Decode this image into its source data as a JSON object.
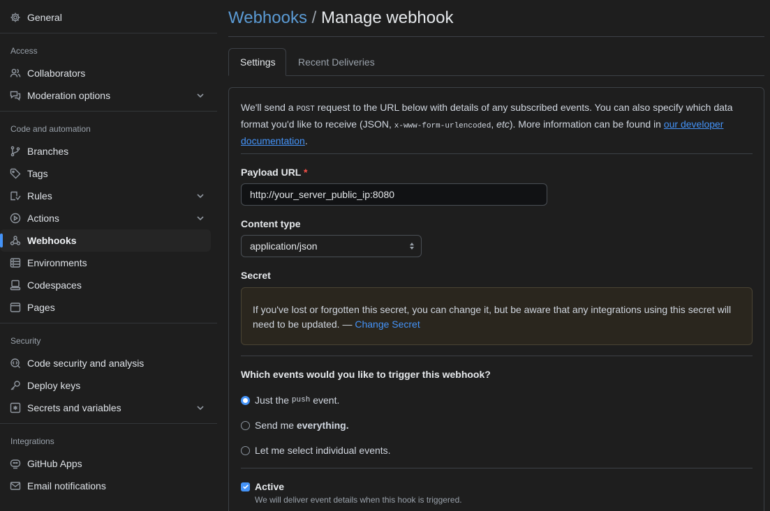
{
  "sidebar": {
    "general": "General",
    "sections": [
      {
        "title": "Access"
      },
      {
        "title": "Code and automation"
      },
      {
        "title": "Security"
      },
      {
        "title": "Integrations"
      }
    ],
    "items": [
      {
        "label": "Collaborators",
        "icon": "people-icon"
      },
      {
        "label": "Moderation options",
        "icon": "comment-discussion-icon"
      },
      {
        "label": "Branches",
        "icon": "git-branch-icon"
      },
      {
        "label": "Tags",
        "icon": "tag-icon"
      },
      {
        "label": "Rules",
        "icon": "rules-icon"
      },
      {
        "label": "Actions",
        "icon": "play-icon"
      },
      {
        "label": "Webhooks",
        "icon": "webhook-icon",
        "active": true
      },
      {
        "label": "Environments",
        "icon": "server-icon"
      },
      {
        "label": "Codespaces",
        "icon": "codespaces-icon"
      },
      {
        "label": "Pages",
        "icon": "browser-icon"
      },
      {
        "label": "Code security and analysis",
        "icon": "codescan-icon"
      },
      {
        "label": "Deploy keys",
        "icon": "key-icon"
      },
      {
        "label": "Secrets and variables",
        "icon": "key-asterisk-icon"
      },
      {
        "label": "GitHub Apps",
        "icon": "hubot-icon"
      },
      {
        "label": "Email notifications",
        "icon": "mail-icon"
      }
    ]
  },
  "header": {
    "breadcrumb": "Webhooks",
    "separator": " / ",
    "title": "Manage webhook"
  },
  "tabs": [
    {
      "label": "Settings",
      "selected": true
    },
    {
      "label": "Recent Deliveries",
      "selected": false
    }
  ],
  "form": {
    "intro_1": "We'll send a ",
    "intro_post": "POST",
    "intro_2": " request to the URL below with details of any subscribed events. You can also specify which data format you'd like to receive (JSON, ",
    "intro_mono": "x-www-form-urlencoded",
    "intro_3": ", ",
    "intro_etc": "etc",
    "intro_4": "). More information can be found in ",
    "intro_link": "our developer documentation",
    "intro_5": ".",
    "payload_label": "Payload URL",
    "required_mark": "*",
    "payload_value": "http://your_server_public_ip:8080",
    "content_type_label": "Content type",
    "content_type_value": "application/json",
    "secret_label": "Secret",
    "secret_text": "If you've lost or forgotten this secret, you can change it, but be aware that any integrations using this secret will need to be updated. — ",
    "secret_link": "Change Secret",
    "events_question": "Which events would you like to trigger this webhook?",
    "event_push_1": "Just the ",
    "event_push_code": "push",
    "event_push_2": " event.",
    "event_everything_1": "Send me ",
    "event_everything_bold": "everything.",
    "event_individual": "Let me select individual events.",
    "active_label": "Active",
    "active_note": "We will deliver event details when this hook is triggered."
  },
  "colors": {
    "accent": "#4493f8",
    "required": "#f85149",
    "background": "#1e1e1e"
  }
}
